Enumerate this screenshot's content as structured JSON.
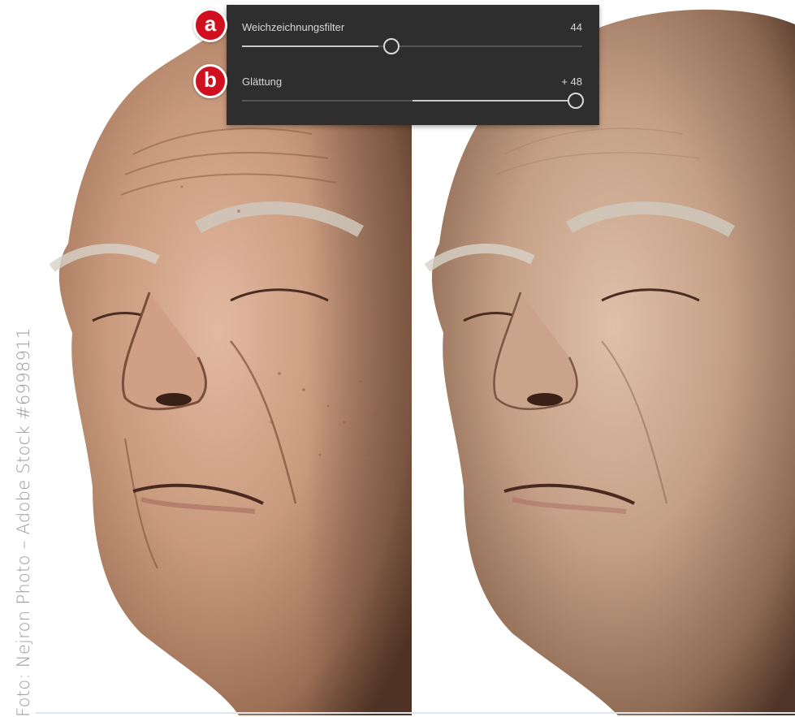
{
  "credit": "Foto: Nejron Photo – Adobe Stock #6998911",
  "panel": {
    "sliders": [
      {
        "badge": "a",
        "label": "Weichzeichnungsfilter",
        "value": "44",
        "level_fraction": 0.44
      },
      {
        "badge": "b",
        "label": "Glättung",
        "value": "+ 48",
        "level_fraction": 0.98
      }
    ]
  },
  "images": [
    {
      "name": "before-portrait",
      "description_icon": "portrait-photo-icon"
    },
    {
      "name": "after-portrait",
      "description_icon": "portrait-photo-icon"
    }
  ]
}
